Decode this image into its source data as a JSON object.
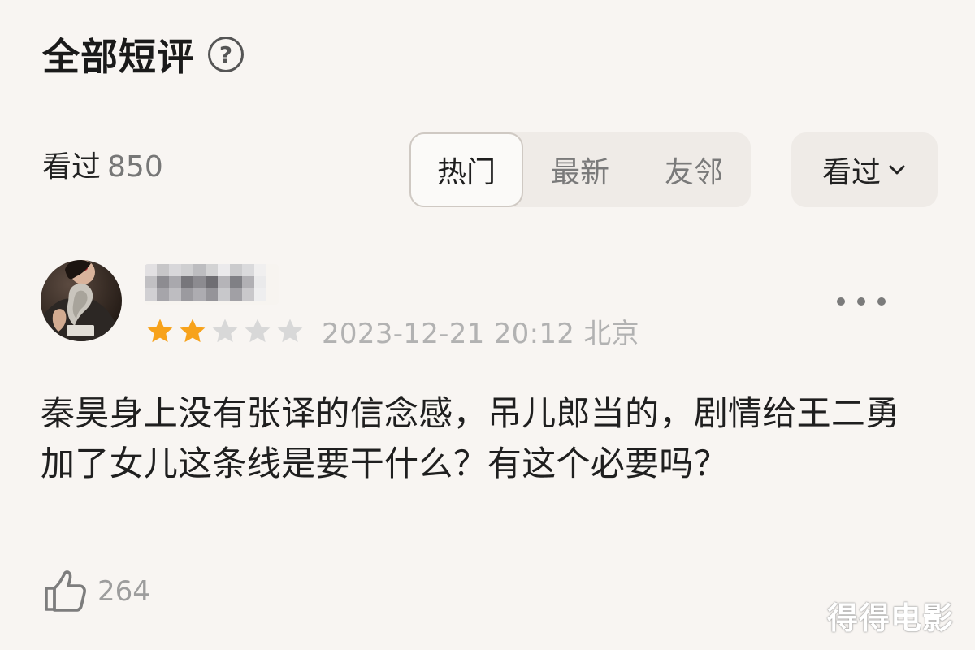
{
  "header": {
    "title": "全部短评",
    "help_icon": "?"
  },
  "filters": {
    "count_label": "看过",
    "count_value": "850",
    "tabs": [
      {
        "label": "热门",
        "active": true
      },
      {
        "label": "最新",
        "active": false
      },
      {
        "label": "友邻",
        "active": false
      }
    ],
    "dropdown_label": "看过"
  },
  "comment": {
    "rating": {
      "value": 2,
      "max": 5
    },
    "timestamp": "2023-12-21 20:12 北京",
    "text": "秦昊身上没有张译的信念感，吊儿郎当的，剧情给王二勇加了女儿这条线是要干什么？有这个必要吗？",
    "likes": "264"
  },
  "watermark": "得得电影",
  "colors": {
    "background": "#f8f5f2",
    "star_active": "#f7a21b",
    "star_inactive": "#d8d8d8"
  },
  "icons": {
    "help": "question-circle-icon",
    "dropdown": "chevron-down-icon",
    "more": "more-horizontal-icon",
    "like": "thumbs-up-icon"
  }
}
